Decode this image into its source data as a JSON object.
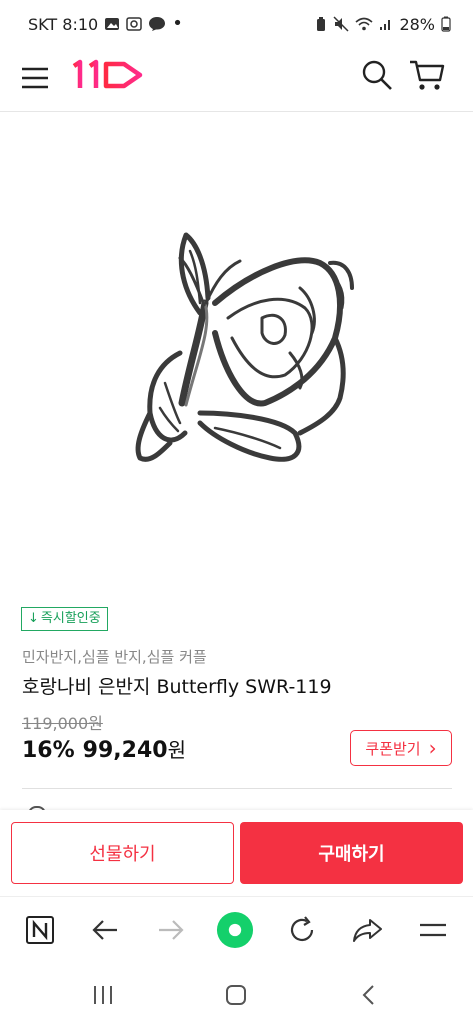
{
  "status_bar": {
    "carrier_time": "SKT 8:10",
    "battery": "28%"
  },
  "header": {
    "logo_text": "11",
    "brand_color": "#f43142"
  },
  "product": {
    "badge": "즉시할인중",
    "badge_arrow": "↓",
    "category": "민자반지,심플 반지,심플 커플",
    "title": "호랑나비 은반지 Butterfly SWR-119",
    "original_price": "119,000원",
    "discount": "16%",
    "price": "99,240",
    "price_unit": "원",
    "coupon_label": "쿠폰받기",
    "coupon_arrow": "›"
  },
  "actions": {
    "gift_label": "선물하기",
    "buy_label": "구매하기"
  },
  "browser_toolbar": {
    "items": [
      "naver-home-icon",
      "back-icon",
      "forward-icon",
      "green-dot-icon",
      "refresh-icon",
      "share-icon",
      "menu-icon"
    ]
  },
  "system_nav": {
    "items": [
      "recents-icon",
      "home-icon",
      "back-icon"
    ]
  }
}
